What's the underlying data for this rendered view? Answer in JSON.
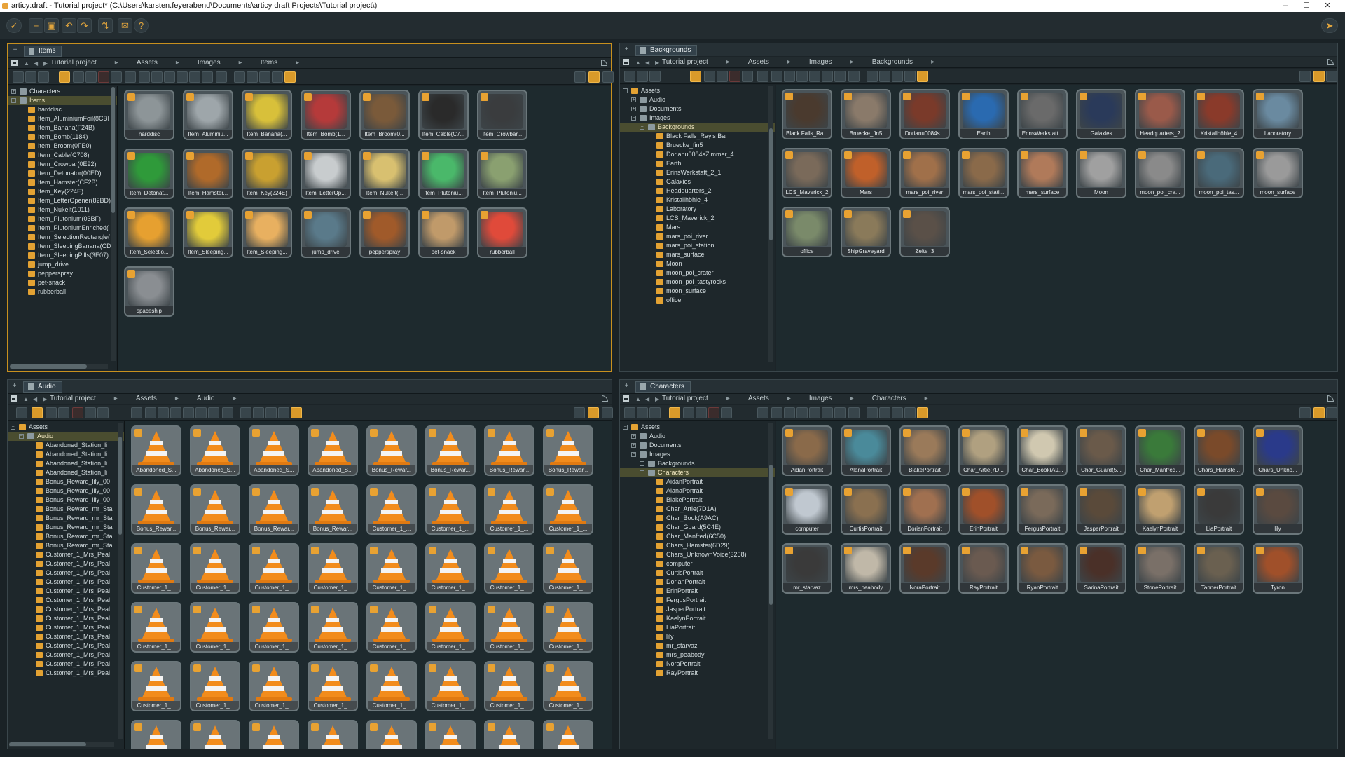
{
  "titlebar": {
    "title": "articy:draft - Tutorial project* (C:\\Users\\karsten.feyerabend\\Documents\\articy draft Projects\\Tutorial project\\)",
    "minimize": "–",
    "maximize": "☐",
    "close": "✕"
  },
  "toolbar": {
    "buttons": [
      "back-icon",
      "new-icon",
      "save-icon",
      "undo-icon",
      "redo-icon",
      "sync-icon",
      "mail-icon",
      "help-icon"
    ],
    "undo": "↶",
    "redo": "↷",
    "help": "?"
  },
  "items_panel": {
    "tab": "Items",
    "breadcrumb": [
      "Tutorial project",
      "Assets",
      "Images",
      "Items"
    ],
    "tree": [
      {
        "label": "Characters",
        "level": 0,
        "type": "book",
        "expander": "+"
      },
      {
        "label": "Items",
        "level": 0,
        "type": "book",
        "expander": "−",
        "selected": true
      },
      {
        "label": "harddisc",
        "level": 1,
        "type": "folder"
      },
      {
        "label": "Item_AluminiumFoil(8CBI",
        "level": 1,
        "type": "folder"
      },
      {
        "label": "Item_Banana(F24B)",
        "level": 1,
        "type": "folder"
      },
      {
        "label": "Item_Bomb(1184)",
        "level": 1,
        "type": "folder"
      },
      {
        "label": "Item_Broom(0FE0)",
        "level": 1,
        "type": "folder"
      },
      {
        "label": "Item_Cable(C708)",
        "level": 1,
        "type": "folder"
      },
      {
        "label": "Item_Crowbar(0E92)",
        "level": 1,
        "type": "folder"
      },
      {
        "label": "Item_Detonator(00ED)",
        "level": 1,
        "type": "folder"
      },
      {
        "label": "Item_Hamster(CF2B)",
        "level": 1,
        "type": "folder"
      },
      {
        "label": "Item_Key(224E)",
        "level": 1,
        "type": "folder"
      },
      {
        "label": "Item_LetterOpener(82BD)",
        "level": 1,
        "type": "folder"
      },
      {
        "label": "Item_NukeIt(1011)",
        "level": 1,
        "type": "folder"
      },
      {
        "label": "Item_Plutonium(03BF)",
        "level": 1,
        "type": "folder"
      },
      {
        "label": "Item_PlutoniumEnriched(",
        "level": 1,
        "type": "folder"
      },
      {
        "label": "Item_SelectionRectangle(",
        "level": 1,
        "type": "folder"
      },
      {
        "label": "Item_SleepingBanana(CD",
        "level": 1,
        "type": "folder"
      },
      {
        "label": "Item_SleepingPills(3E07)",
        "level": 1,
        "type": "folder"
      },
      {
        "label": "jump_drive",
        "level": 1,
        "type": "folder"
      },
      {
        "label": "pepperspray",
        "level": 1,
        "type": "folder"
      },
      {
        "label": "pet-snack",
        "level": 1,
        "type": "folder"
      },
      {
        "label": "rubberball",
        "level": 1,
        "type": "folder"
      }
    ],
    "tiles": [
      {
        "label": "harddisc",
        "color": "#8d9598"
      },
      {
        "label": "Item_Aluminiu...",
        "color": "#9ea6aa"
      },
      {
        "label": "Item_Banana(...",
        "color": "#d8c03a"
      },
      {
        "label": "Item_Bomb(1...",
        "color": "#b53a3a"
      },
      {
        "label": "Item_Broom(0...",
        "color": "#7a5a3a"
      },
      {
        "label": "Item_Cable(C7...",
        "color": "#2a2a2a"
      },
      {
        "label": "Item_Crowbar...",
        "color": "#3a3c3e"
      },
      {
        "label": "Item_Detonat...",
        "color": "#2f9a3a"
      },
      {
        "label": "Item_Hamster...",
        "color": "#b06a2a"
      },
      {
        "label": "Item_Key(224E)",
        "color": "#c9a030"
      },
      {
        "label": "Item_LetterOp...",
        "color": "#c8ccce"
      },
      {
        "label": "Item_NukeIt(...",
        "color": "#d8c070"
      },
      {
        "label": "Item_Plutoniu...",
        "color": "#4ab86a"
      },
      {
        "label": "Item_Plutoniu...",
        "color": "#8aa070"
      },
      {
        "label": "Item_Selectio...",
        "color": "#e6a030"
      },
      {
        "label": "Item_Sleeping...",
        "color": "#e2cb3a"
      },
      {
        "label": "Item_Sleeping...",
        "color": "#e8b060"
      },
      {
        "label": "jump_drive",
        "color": "#5a7a8a"
      },
      {
        "label": "pepperspray",
        "color": "#a05a2a"
      },
      {
        "label": "pet-snack",
        "color": "#c09a6a"
      },
      {
        "label": "rubberball",
        "color": "#e04a3a"
      },
      {
        "label": "spaceship",
        "color": "#8a8e92"
      }
    ]
  },
  "backgrounds_panel": {
    "tab": "Backgrounds",
    "breadcrumb": [
      "Tutorial project",
      "Assets",
      "Images",
      "Backgrounds"
    ],
    "tree": [
      {
        "label": "Assets",
        "level": 0,
        "type": "folder",
        "expander": "−"
      },
      {
        "label": "Audio",
        "level": 1,
        "type": "book",
        "expander": "+"
      },
      {
        "label": "Documents",
        "level": 1,
        "type": "book",
        "expander": "+"
      },
      {
        "label": "Images",
        "level": 1,
        "type": "book",
        "expander": "−"
      },
      {
        "label": "Backgrounds",
        "level": 2,
        "type": "book",
        "expander": "−",
        "selected": true
      },
      {
        "label": "Black Falls_Ray's Bar",
        "level": 3,
        "type": "folder"
      },
      {
        "label": "Bruecke_fin5",
        "level": 3,
        "type": "folder"
      },
      {
        "label": "Dorianu0084sZimmer_4",
        "level": 3,
        "type": "folder"
      },
      {
        "label": "Earth",
        "level": 3,
        "type": "folder"
      },
      {
        "label": "ErinsWerkstatt_2_1",
        "level": 3,
        "type": "folder"
      },
      {
        "label": "Galaxies",
        "level": 3,
        "type": "folder"
      },
      {
        "label": "Headquarters_2",
        "level": 3,
        "type": "folder"
      },
      {
        "label": "Kristallhöhle_4",
        "level": 3,
        "type": "folder"
      },
      {
        "label": "Laboratory",
        "level": 3,
        "type": "folder"
      },
      {
        "label": "LCS_Maverick_2",
        "level": 3,
        "type": "folder"
      },
      {
        "label": "Mars",
        "level": 3,
        "type": "folder"
      },
      {
        "label": "mars_poi_river",
        "level": 3,
        "type": "folder"
      },
      {
        "label": "mars_poi_station",
        "level": 3,
        "type": "folder"
      },
      {
        "label": "mars_surface",
        "level": 3,
        "type": "folder"
      },
      {
        "label": "Moon",
        "level": 3,
        "type": "folder"
      },
      {
        "label": "moon_poi_crater",
        "level": 3,
        "type": "folder"
      },
      {
        "label": "moon_poi_tastyrocks",
        "level": 3,
        "type": "folder"
      },
      {
        "label": "moon_surface",
        "level": 3,
        "type": "folder"
      },
      {
        "label": "office",
        "level": 3,
        "type": "folder"
      }
    ],
    "tiles": [
      {
        "label": "Black Falls_Ra...",
        "color": "#4a3a2e"
      },
      {
        "label": "Bruecke_fin5",
        "color": "#8a7a6a"
      },
      {
        "label": "Dorianu0084s...",
        "color": "#7a3a2a"
      },
      {
        "label": "Earth",
        "color": "#2a6ab0"
      },
      {
        "label": "ErinsWerkstatt...",
        "color": "#6a6a6a"
      },
      {
        "label": "Galaxies",
        "color": "#2a3a5a"
      },
      {
        "label": "Headquarters_2",
        "color": "#9a5a4a"
      },
      {
        "label": "Kristallhöhle_4",
        "color": "#8a3a2a"
      },
      {
        "label": "Laboratory",
        "color": "#6a8aa0"
      },
      {
        "label": "LCS_Maverick_2",
        "color": "#7a6a5a"
      },
      {
        "label": "Mars",
        "color": "#c0602a"
      },
      {
        "label": "mars_poi_river",
        "color": "#a0704a"
      },
      {
        "label": "mars_poi_stati...",
        "color": "#8a6a4a"
      },
      {
        "label": "mars_surface",
        "color": "#b07a5a"
      },
      {
        "label": "Moon",
        "color": "#a0a0a0"
      },
      {
        "label": "moon_poi_cra...",
        "color": "#8a8a8a"
      },
      {
        "label": "moon_poi_tas...",
        "color": "#4a6a7a"
      },
      {
        "label": "moon_surface",
        "color": "#9a9a9a"
      },
      {
        "label": "office",
        "color": "#7a8a6a"
      },
      {
        "label": "ShipGraveyard",
        "color": "#8a7a5a"
      },
      {
        "label": "Zelte_3",
        "color": "#5a5048"
      }
    ]
  },
  "audio_panel": {
    "tab": "Audio",
    "breadcrumb": [
      "Tutorial project",
      "Assets",
      "Audio"
    ],
    "tree": [
      {
        "label": "Assets",
        "level": 0,
        "type": "folder",
        "expander": "−"
      },
      {
        "label": "Audio",
        "level": 1,
        "type": "book",
        "expander": "−",
        "selected": true
      },
      {
        "label": "Abandoned_Station_li",
        "level": 2,
        "type": "folder"
      },
      {
        "label": "Abandoned_Station_li",
        "level": 2,
        "type": "folder"
      },
      {
        "label": "Abandoned_Station_li",
        "level": 2,
        "type": "folder"
      },
      {
        "label": "Abandoned_Station_li",
        "level": 2,
        "type": "folder"
      },
      {
        "label": "Bonus_Reward_lily_00",
        "level": 2,
        "type": "folder"
      },
      {
        "label": "Bonus_Reward_lily_00",
        "level": 2,
        "type": "folder"
      },
      {
        "label": "Bonus_Reward_lily_00",
        "level": 2,
        "type": "folder"
      },
      {
        "label": "Bonus_Reward_mr_Sta",
        "level": 2,
        "type": "folder"
      },
      {
        "label": "Bonus_Reward_mr_Sta",
        "level": 2,
        "type": "folder"
      },
      {
        "label": "Bonus_Reward_mr_Sta",
        "level": 2,
        "type": "folder"
      },
      {
        "label": "Bonus_Reward_mr_Sta",
        "level": 2,
        "type": "folder"
      },
      {
        "label": "Bonus_Reward_mr_Sta",
        "level": 2,
        "type": "folder"
      },
      {
        "label": "Customer_1_Mrs_Peal",
        "level": 2,
        "type": "folder"
      },
      {
        "label": "Customer_1_Mrs_Peal",
        "level": 2,
        "type": "folder"
      },
      {
        "label": "Customer_1_Mrs_Peal",
        "level": 2,
        "type": "folder"
      },
      {
        "label": "Customer_1_Mrs_Peal",
        "level": 2,
        "type": "folder"
      },
      {
        "label": "Customer_1_Mrs_Peal",
        "level": 2,
        "type": "folder"
      },
      {
        "label": "Customer_1_Mrs_Peal",
        "level": 2,
        "type": "folder"
      },
      {
        "label": "Customer_1_Mrs_Peal",
        "level": 2,
        "type": "folder"
      },
      {
        "label": "Customer_1_Mrs_Peal",
        "level": 2,
        "type": "folder"
      },
      {
        "label": "Customer_1_Mrs_Peal",
        "level": 2,
        "type": "folder"
      },
      {
        "label": "Customer_1_Mrs_Peal",
        "level": 2,
        "type": "folder"
      },
      {
        "label": "Customer_1_Mrs_Peal",
        "level": 2,
        "type": "folder"
      },
      {
        "label": "Customer_1_Mrs_Peal",
        "level": 2,
        "type": "folder"
      },
      {
        "label": "Customer_1_Mrs_Peal",
        "level": 2,
        "type": "folder"
      },
      {
        "label": "Customer_1_Mrs_Peal",
        "level": 2,
        "type": "folder"
      }
    ],
    "tiles": [
      "Abandoned_S...",
      "Abandoned_S...",
      "Abandoned_S...",
      "Abandoned_S...",
      "Bonus_Rewar...",
      "Bonus_Rewar...",
      "Bonus_Rewar...",
      "Bonus_Rewar...",
      "Bonus_Rewar...",
      "Bonus_Rewar...",
      "Bonus_Rewar...",
      "Bonus_Rewar...",
      "Customer_1_...",
      "Customer_1_...",
      "Customer_1_...",
      "Customer_1_...",
      "Customer_1_...",
      "Customer_1_...",
      "Customer_1_...",
      "Customer_1_...",
      "Customer_1_...",
      "Customer_1_...",
      "Customer_1_...",
      "Customer_1_...",
      "Customer_1_...",
      "Customer_1_...",
      "Customer_1_...",
      "Customer_1_...",
      "Customer_1_...",
      "Customer_1_...",
      "Customer_1_...",
      "Customer_1_...",
      "Customer_1_...",
      "Customer_1_...",
      "Customer_1_...",
      "Customer_1_...",
      "Customer_1_...",
      "Customer_1_...",
      "Customer_1_...",
      "Customer_1_...",
      "",
      "",
      "",
      "",
      "",
      "",
      "",
      ""
    ]
  },
  "characters_panel": {
    "tab": "Characters",
    "breadcrumb": [
      "Tutorial project",
      "Assets",
      "Images",
      "Characters"
    ],
    "tree": [
      {
        "label": "Assets",
        "level": 0,
        "type": "folder",
        "expander": "−"
      },
      {
        "label": "Audio",
        "level": 1,
        "type": "book",
        "expander": "+"
      },
      {
        "label": "Documents",
        "level": 1,
        "type": "book",
        "expander": "+"
      },
      {
        "label": "Images",
        "level": 1,
        "type": "book",
        "expander": "−"
      },
      {
        "label": "Backgrounds",
        "level": 2,
        "type": "book",
        "expander": "+"
      },
      {
        "label": "Characters",
        "level": 2,
        "type": "book",
        "expander": "−",
        "selected": true
      },
      {
        "label": "AidanPortrait",
        "level": 3,
        "type": "folder"
      },
      {
        "label": "AlanaPortrait",
        "level": 3,
        "type": "folder"
      },
      {
        "label": "BlakePortrait",
        "level": 3,
        "type": "folder"
      },
      {
        "label": "Char_Artie(7D1A)",
        "level": 3,
        "type": "folder"
      },
      {
        "label": "Char_Book(A9AC)",
        "level": 3,
        "type": "folder"
      },
      {
        "label": "Char_Guard(5C4E)",
        "level": 3,
        "type": "folder"
      },
      {
        "label": "Char_Manfred(6C50)",
        "level": 3,
        "type": "folder"
      },
      {
        "label": "Chars_Hamster(6D29)",
        "level": 3,
        "type": "folder"
      },
      {
        "label": "Chars_UnknownVoice(3258)",
        "level": 3,
        "type": "folder"
      },
      {
        "label": "computer",
        "level": 3,
        "type": "folder"
      },
      {
        "label": "CurtisPortrait",
        "level": 3,
        "type": "folder"
      },
      {
        "label": "DorianPortrait",
        "level": 3,
        "type": "folder"
      },
      {
        "label": "ErinPortrait",
        "level": 3,
        "type": "folder"
      },
      {
        "label": "FergusPortrait",
        "level": 3,
        "type": "folder"
      },
      {
        "label": "JasperPortrait",
        "level": 3,
        "type": "folder"
      },
      {
        "label": "KaelynPortrait",
        "level": 3,
        "type": "folder"
      },
      {
        "label": "LiaPortrait",
        "level": 3,
        "type": "folder"
      },
      {
        "label": "lily",
        "level": 3,
        "type": "folder"
      },
      {
        "label": "mr_starvaz",
        "level": 3,
        "type": "folder"
      },
      {
        "label": "mrs_peabody",
        "level": 3,
        "type": "folder"
      },
      {
        "label": "NoraPortrait",
        "level": 3,
        "type": "folder"
      },
      {
        "label": "RayPortrait",
        "level": 3,
        "type": "folder"
      }
    ],
    "tiles": [
      {
        "label": "AidanPortrait",
        "color": "#8a6a4a"
      },
      {
        "label": "AlanaPortrait",
        "color": "#4a8a9a"
      },
      {
        "label": "BlakePortrait",
        "color": "#9a7a5a"
      },
      {
        "label": "Char_Artie(7D...",
        "color": "#b0a080"
      },
      {
        "label": "Char_Book(A9...",
        "color": "#d0c8b0"
      },
      {
        "label": "Char_Guard(5...",
        "color": "#6a5a4a"
      },
      {
        "label": "Char_Manfred...",
        "color": "#3a7a3a"
      },
      {
        "label": "Chars_Hamste...",
        "color": "#7a4a2a"
      },
      {
        "label": "Chars_Unkno...",
        "color": "#2a3a8a"
      },
      {
        "label": "computer",
        "color": "#c0c8d0"
      },
      {
        "label": "CurtisPortrait",
        "color": "#8a7050"
      },
      {
        "label": "DorianPortrait",
        "color": "#a07050"
      },
      {
        "label": "ErinPortrait",
        "color": "#a0502a"
      },
      {
        "label": "FergusPortrait",
        "color": "#7a6a5a"
      },
      {
        "label": "JasperPortrait",
        "color": "#5a4a3a"
      },
      {
        "label": "KaelynPortrait",
        "color": "#c0a070"
      },
      {
        "label": "LiaPortrait",
        "color": "#3a3a3a"
      },
      {
        "label": "lily",
        "color": "#5a4a40"
      },
      {
        "label": "mr_starvaz",
        "color": "#3a3a3a"
      },
      {
        "label": "mrs_peabody",
        "color": "#c0b8a8"
      },
      {
        "label": "NoraPortrait",
        "color": "#5a3a2a"
      },
      {
        "label": "RayPortrait",
        "color": "#6a5a50"
      },
      {
        "label": "RyanPortrait",
        "color": "#7a5a40"
      },
      {
        "label": "SarinaPortrait",
        "color": "#4a3028"
      },
      {
        "label": "StonePortrait",
        "color": "#7a7068"
      },
      {
        "label": "TannerPortrait",
        "color": "#6a6050"
      },
      {
        "label": "Tyron",
        "color": "#a0502a"
      }
    ]
  },
  "colors": {
    "accent": "#e8a232",
    "panel": "#1e2a2e",
    "selection": "#4a4d30"
  }
}
